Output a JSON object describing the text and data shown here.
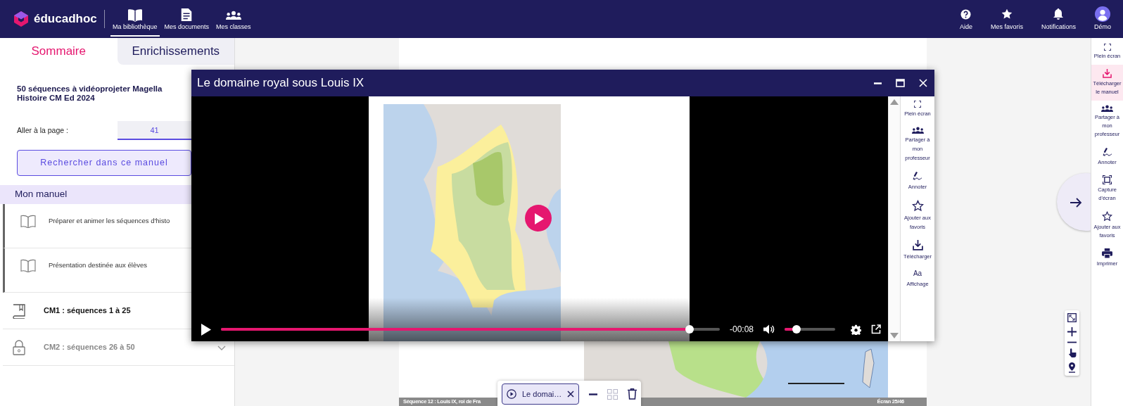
{
  "top_nav": {
    "logo": "éducadhoc",
    "items": [
      {
        "label": "Ma bibliothèque",
        "selected": true
      },
      {
        "label": "Mes documents",
        "selected": false
      },
      {
        "label": "Mes classes",
        "selected": false
      }
    ],
    "actions": [
      {
        "label": "Aide"
      },
      {
        "label": "Mes favoris"
      },
      {
        "label": "Notifications"
      },
      {
        "label": "Démo"
      }
    ]
  },
  "sidebar": {
    "tabs": [
      {
        "label": "Sommaire",
        "selected": true
      },
      {
        "label": "Enrichissements",
        "selected": false
      }
    ],
    "title_lines": [
      "50 séquences à vidéoprojeter Magella",
      "Histoire CM Ed 2024"
    ],
    "goto_label": "Aller à la page :",
    "goto_value": "41",
    "search_button": "Rechercher dans ce manuel",
    "section": "Mon manuel",
    "resources": [
      {
        "label": "Préparer et animer les séquences d'histo"
      },
      {
        "label": "Présentation destinée aux élèves"
      }
    ],
    "chapters": [
      {
        "label": "CM1 : séquences 1 à 25",
        "locked": false
      },
      {
        "label": "CM2 : séquences 26 à 50",
        "locked": true
      }
    ]
  },
  "document": {
    "footer_left": "Séquence 12 : Louis IX, roi de Fra",
    "footer_right": "Écran 25/46"
  },
  "video_window": {
    "title": "Le domaine royal sous Louis IX",
    "progress": {
      "level": 0.94
    },
    "time": "-00:08",
    "volume": {
      "level": 0.24
    },
    "tools": [
      {
        "label": "Plein écran"
      },
      {
        "label": "Partager à mon professeur"
      },
      {
        "label": "Annoter"
      },
      {
        "label": "Ajouter aux favoris"
      },
      {
        "label": "Télécharger"
      },
      {
        "label": "Affichage",
        "glyph": "Aa"
      }
    ]
  },
  "right_toolbar": [
    {
      "label": "Plein écran",
      "selected": false
    },
    {
      "label": "Télécharger le manuel",
      "selected": true
    },
    {
      "label": "Partager à mon professeur",
      "selected": false
    },
    {
      "label": "Annoter",
      "selected": false
    },
    {
      "label": "Capture d'écran",
      "selected": false
    },
    {
      "label": "Ajouter aux favoris",
      "selected": false
    },
    {
      "label": "Imprimer",
      "selected": false
    }
  ],
  "bottom_bar": {
    "tab": "Le domai…",
    "grid_disabled": true
  }
}
